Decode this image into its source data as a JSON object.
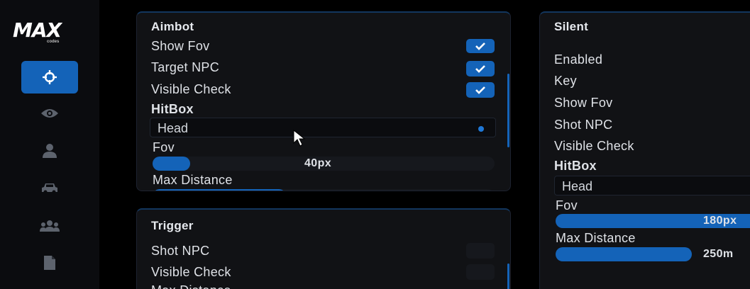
{
  "sidebar": {
    "logo_text": "MAX",
    "logo_sub": "codes",
    "nav_icons": [
      "crosshair-icon",
      "eye-icon",
      "user-icon",
      "car-icon",
      "users-icon",
      "file-icon"
    ],
    "active_index": 0
  },
  "aimbot": {
    "title": "Aimbot",
    "show_fov": {
      "label": "Show Fov",
      "checked": true
    },
    "target_npc": {
      "label": "Target NPC",
      "checked": true
    },
    "visible_check": {
      "label": "Visible Check",
      "checked": true
    },
    "hitbox_label": "HitBox",
    "hitbox_value": "Head",
    "fov_label": "Fov",
    "fov_value": "40px",
    "fov_fraction": 0.11,
    "max_distance_label": "Max Distance",
    "max_distance_fraction": 0.39
  },
  "trigger": {
    "title": "Trigger",
    "shot_npc": {
      "label": "Shot NPC",
      "checked": false
    },
    "visible_check": {
      "label": "Visible Check",
      "checked": false
    },
    "max_distance_label": "Max Distance"
  },
  "silent": {
    "title": "Silent",
    "enabled_label": "Enabled",
    "key_label": "Key",
    "show_fov_label": "Show Fov",
    "shot_npc_label": "Shot NPC",
    "visible_check_label": "Visible Check",
    "hitbox_label": "HitBox",
    "hitbox_value": "Head",
    "fov_label": "Fov",
    "fov_value": "180px",
    "max_distance_label": "Max Distance",
    "max_distance_value": "250m"
  },
  "colors": {
    "accent": "#1463b8",
    "panel": "#111215",
    "background": "#000000"
  }
}
